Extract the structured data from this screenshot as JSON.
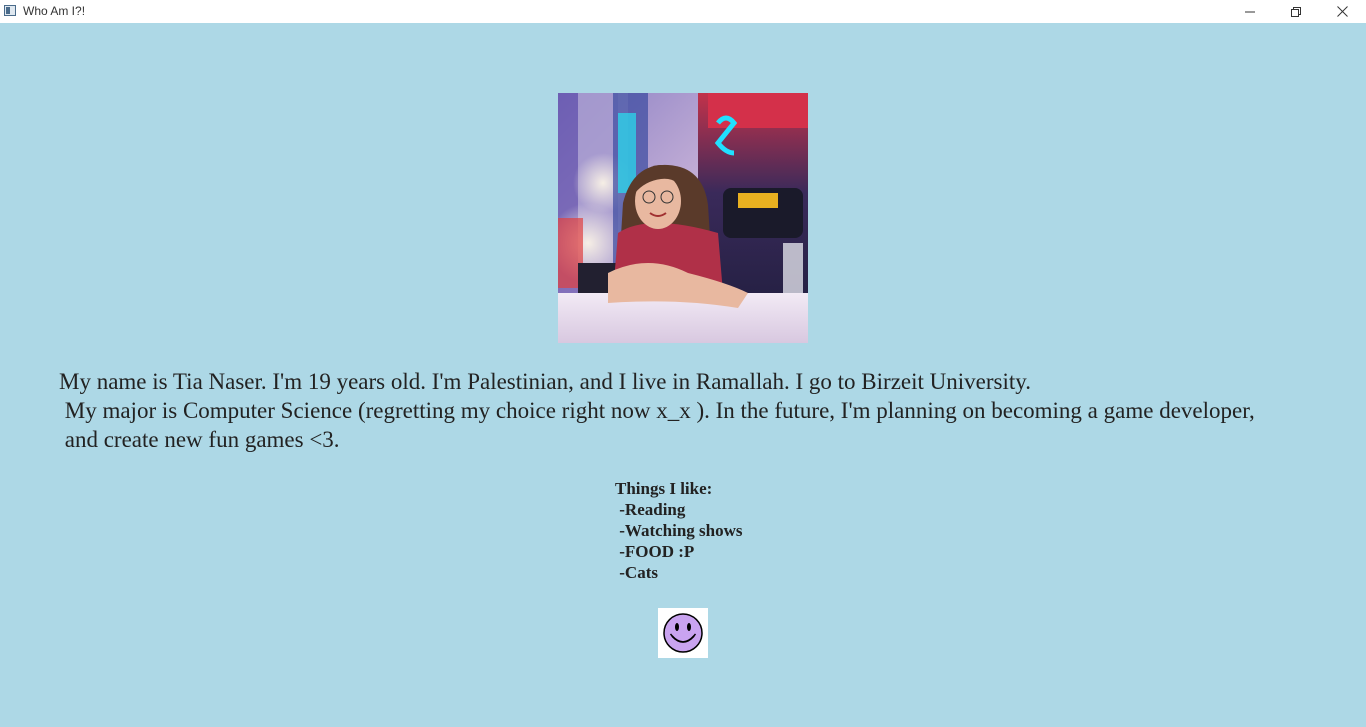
{
  "window": {
    "title": "Who Am I?!"
  },
  "titlebar_icons": {
    "app": "app-window-icon",
    "minimize": "minimize-icon",
    "maximize": "restore-icon",
    "close": "close-icon"
  },
  "photo": {
    "description_icon": "profile-photo"
  },
  "bio": {
    "lines": [
      "My name is Tia Naser. I'm 19 years old. I'm Palestinian, and I live in Ramallah. I go to Birzeit University.",
      " My major is Computer Science (regretting my choice right now x_x ). In the future, I'm planning on becoming a game developer,",
      " and create new fun games <3."
    ]
  },
  "likes": {
    "heading": "Things I like:",
    "items": [
      " -Reading",
      " -Watching shows",
      " -FOOD :P",
      " -Cats"
    ]
  },
  "smiley": {
    "icon": "smiley-face-icon",
    "color": "#c9a3f0"
  }
}
